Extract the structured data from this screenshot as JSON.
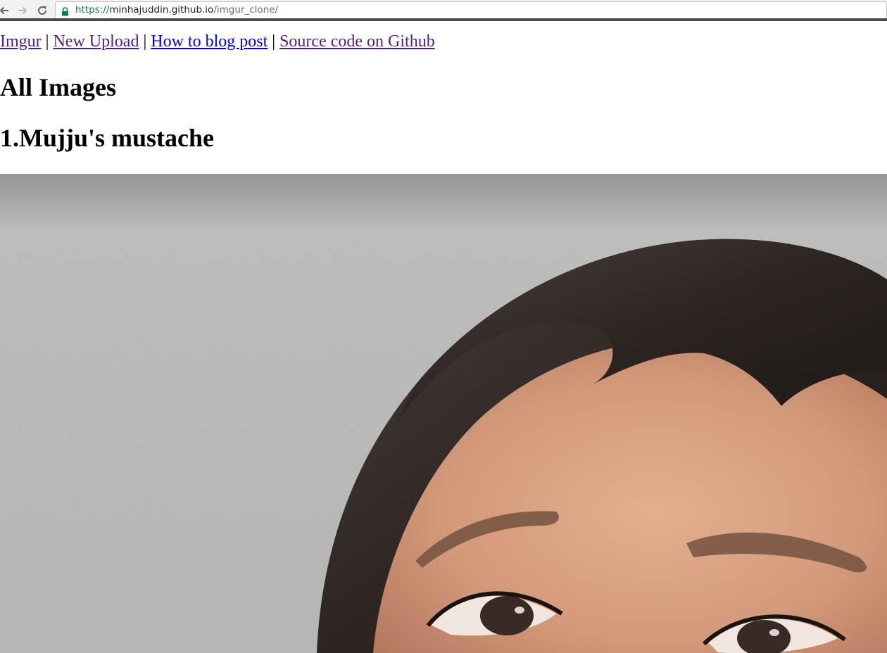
{
  "browser": {
    "url": {
      "scheme": "https://",
      "host": "minhajuddin.github.io",
      "path": "/imgur_clone/"
    },
    "icons": {
      "back": "arrow-left-icon",
      "forward": "arrow-right-icon",
      "reload": "reload-icon",
      "secure": "lock-icon"
    }
  },
  "nav": {
    "links": [
      {
        "label": "Imgur",
        "state": "visited"
      },
      {
        "label": "New Upload",
        "state": "visited"
      },
      {
        "label": "How to blog post",
        "state": "unvisited"
      },
      {
        "label": "Source code on Github",
        "state": "visited"
      }
    ],
    "separator": "|"
  },
  "page": {
    "heading": "All Images"
  },
  "images": [
    {
      "title": "1.Mujju's mustache"
    }
  ],
  "colors": {
    "link_visited": "#551a8b",
    "link_unvisited": "#0000ee",
    "secure_url": "#0b8043"
  }
}
